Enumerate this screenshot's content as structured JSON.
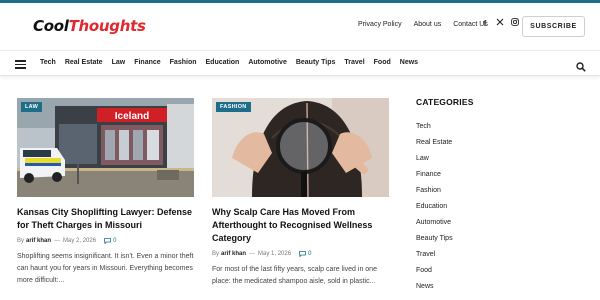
{
  "brand": {
    "part1": "Cool",
    "part2": "Thoughts",
    "accent": "#e0282e",
    "theme": "#1e6e8a"
  },
  "top_links": [
    "Privacy Policy",
    "About us",
    "Contact Us"
  ],
  "social_icons": [
    "facebook-icon",
    "x-twitter-icon",
    "instagram-icon"
  ],
  "subscribe_label": "SUBSCRIBE",
  "nav": {
    "items": [
      "Tech",
      "Real Estate",
      "Law",
      "Finance",
      "Fashion",
      "Education",
      "Automotive",
      "Beauty Tips",
      "Travel",
      "Food",
      "News"
    ]
  },
  "articles": [
    {
      "category": "LAW",
      "title": "Kansas City Shoplifting Lawyer: Defense for Theft Charges in Missouri",
      "by": "By",
      "author": "arif khan",
      "sep": "—",
      "date": "May 2, 2026",
      "comments": "0",
      "excerpt": "Shoplifting seems insignificant. It isn't. Even a minor theft can haunt you for years in Missouri. Everything becomes more difficult:...",
      "image_text": "Iceland"
    },
    {
      "category": "FASHION",
      "title": "Why Scalp Care Has Moved From Afterthought to Recognised Wellness Category",
      "by": "By",
      "author": "arif khan",
      "sep": "—",
      "date": "May 1, 2026",
      "comments": "0",
      "excerpt": "For most of the last fifty years, scalp care lived in one place: the medicated shampoo aisle, sold in plastic..."
    }
  ],
  "sidebar": {
    "title": "CATEGORIES",
    "categories": [
      "Tech",
      "Real Estate",
      "Law",
      "Finance",
      "Fashion",
      "Education",
      "Automotive",
      "Beauty Tips",
      "Travel",
      "Food",
      "News"
    ]
  }
}
